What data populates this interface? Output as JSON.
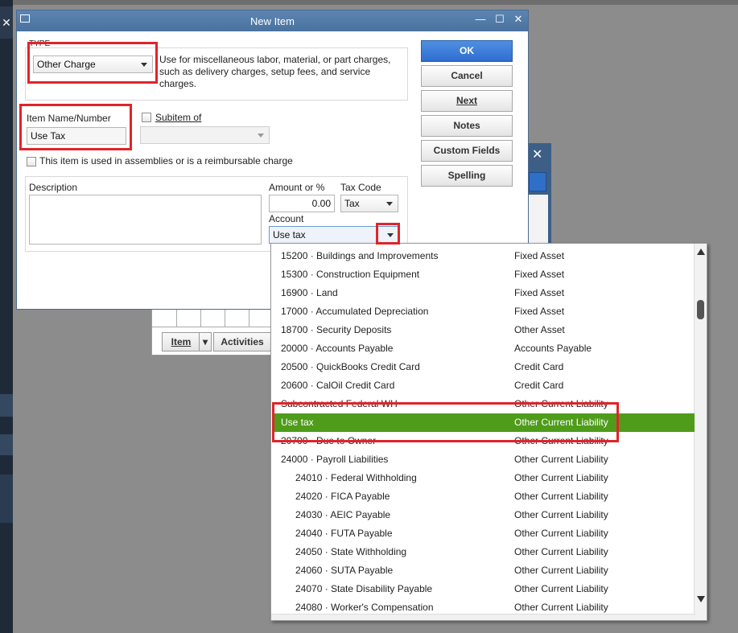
{
  "dialog": {
    "title": "New Item",
    "type_label": "TYPE",
    "type_value": "Other Charge",
    "type_description": "Use for miscellaneous labor, material, or part charges, such as delivery charges, setup fees, and service charges.",
    "item_name_label": "Item Name/Number",
    "item_name_value": "Use Tax",
    "subitem_label": "Subitem of",
    "assembly_checkbox_label": "This item is used in assemblies or is a reimbursable charge",
    "description_label": "Description",
    "amount_label": "Amount or %",
    "amount_value": "0.00",
    "tax_code_label": "Tax Code",
    "tax_code_value": "Tax",
    "account_label": "Account",
    "account_value": "Use tax",
    "buttons": {
      "ok": "OK",
      "cancel": "Cancel",
      "next": "Next",
      "notes": "Notes",
      "custom_fields": "Custom Fields",
      "spelling": "Spelling"
    }
  },
  "background": {
    "item_button": "Item",
    "activities_button": "Activities"
  },
  "account_dropdown": {
    "selected_index": 9,
    "rows": [
      {
        "name": "15200 · Buildings and Improvements",
        "type": "Fixed Asset",
        "indent": 0
      },
      {
        "name": "15300 · Construction Equipment",
        "type": "Fixed Asset",
        "indent": 0
      },
      {
        "name": "16900 · Land",
        "type": "Fixed Asset",
        "indent": 0
      },
      {
        "name": "17000 · Accumulated Depreciation",
        "type": "Fixed Asset",
        "indent": 0
      },
      {
        "name": "18700 · Security Deposits",
        "type": "Other Asset",
        "indent": 0
      },
      {
        "name": "20000 · Accounts Payable",
        "type": "Accounts Payable",
        "indent": 0
      },
      {
        "name": "20500 · QuickBooks Credit Card",
        "type": "Credit Card",
        "indent": 0
      },
      {
        "name": "20600 · CalOil Credit Card",
        "type": "Credit Card",
        "indent": 0
      },
      {
        "name": "Subcontracted Federal WH",
        "type": "Other Current Liability",
        "indent": 0
      },
      {
        "name": "Use tax",
        "type": "Other Current Liability",
        "indent": 0
      },
      {
        "name": "20700 · Due to Owner",
        "type": "Other Current Liability",
        "indent": 0
      },
      {
        "name": "24000 · Payroll Liabilities",
        "type": "Other Current Liability",
        "indent": 0
      },
      {
        "name": "24010 · Federal Withholding",
        "type": "Other Current Liability",
        "indent": 1
      },
      {
        "name": "24020 · FICA Payable",
        "type": "Other Current Liability",
        "indent": 1
      },
      {
        "name": "24030 · AEIC Payable",
        "type": "Other Current Liability",
        "indent": 1
      },
      {
        "name": "24040 · FUTA Payable",
        "type": "Other Current Liability",
        "indent": 1
      },
      {
        "name": "24050 · State Withholding",
        "type": "Other Current Liability",
        "indent": 1
      },
      {
        "name": "24060 · SUTA Payable",
        "type": "Other Current Liability",
        "indent": 1
      },
      {
        "name": "24070 · State Disability Payable",
        "type": "Other Current Liability",
        "indent": 1
      },
      {
        "name": "24080 · Worker's Compensation",
        "type": "Other Current Liability",
        "indent": 1
      }
    ]
  },
  "colors": {
    "selected_row": "#4e9c1a",
    "annotation_red": "#e0242a",
    "ok_button": "#2f6ecf",
    "titlebar": "#5c85b3"
  }
}
